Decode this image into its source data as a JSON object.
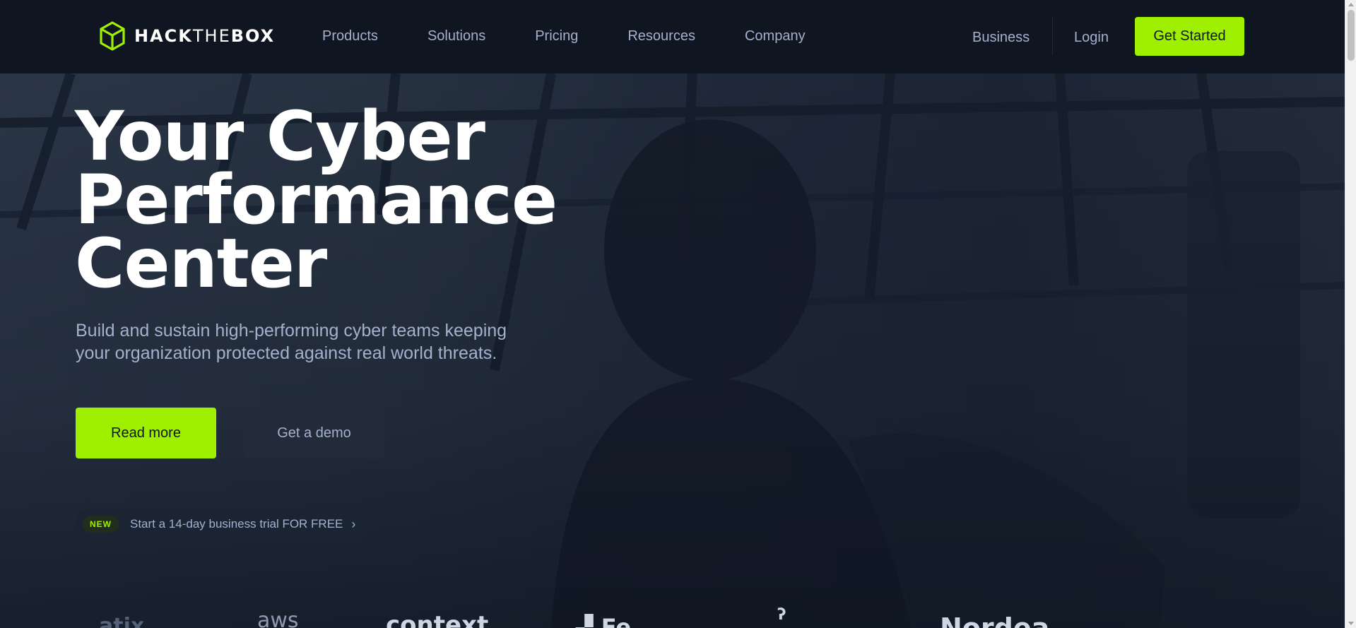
{
  "brand": {
    "logo_bold": "HACK",
    "logo_thin": "THE",
    "logo_bold2": "BOX",
    "accent_color": "#9fef00"
  },
  "nav": {
    "items": [
      "Products",
      "Solutions",
      "Pricing",
      "Resources",
      "Company"
    ],
    "business": "Business",
    "login": "Login",
    "get_started": "Get Started"
  },
  "hero": {
    "title_lines": [
      "Your Cyber",
      "Performance",
      "Center"
    ],
    "subtitle": "Build and sustain high-performing cyber teams keeping your organization protected against real world threats.",
    "read_more": "Read more",
    "get_demo": "Get a demo",
    "trial_badge": "NEW",
    "trial_text": "Start a 14-day business trial FOR FREE"
  },
  "logos": [
    "aws",
    "context",
    "Nordea"
  ]
}
